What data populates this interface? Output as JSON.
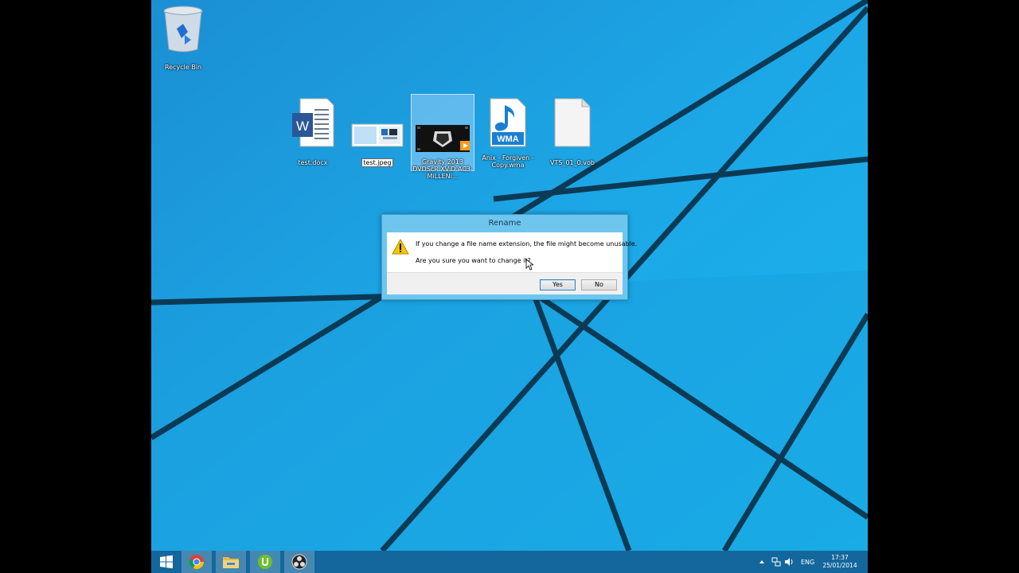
{
  "desktop": {
    "icons": [
      {
        "label": "Recycle Bin",
        "icon": "recycle-bin-icon"
      },
      {
        "label": "test.docx",
        "icon": "word-document-icon"
      },
      {
        "label": "test.jpeg",
        "icon": "image-file-icon"
      },
      {
        "label": "Gravity 2013 DVDScR XViD AC3-MiLLENi...",
        "icon": "video-file-icon"
      },
      {
        "label": "Anix - Forgiven - Copy.wma",
        "icon": "wma-audio-icon"
      },
      {
        "label": "VTS_01_0.vob",
        "icon": "blank-file-icon"
      }
    ],
    "wma_badge": "WMA",
    "word_badge": "W"
  },
  "dialog": {
    "title": "Rename",
    "message": "If you change a file name extension, the file might become unusable.",
    "question": "Are you sure you want to change it?",
    "yes_label": "Yes",
    "no_label": "No"
  },
  "taskbar": {
    "apps": [
      "windows-start-icon",
      "chrome-icon",
      "file-explorer-icon",
      "utorrent-icon",
      "obs-icon"
    ],
    "language": "ENG",
    "time": "17:37",
    "date": "25/01/2014"
  },
  "colors": {
    "desktop_bg": "#1ba1e2",
    "dialog_frame": "#6ec6ee",
    "taskbar": "#126296"
  }
}
